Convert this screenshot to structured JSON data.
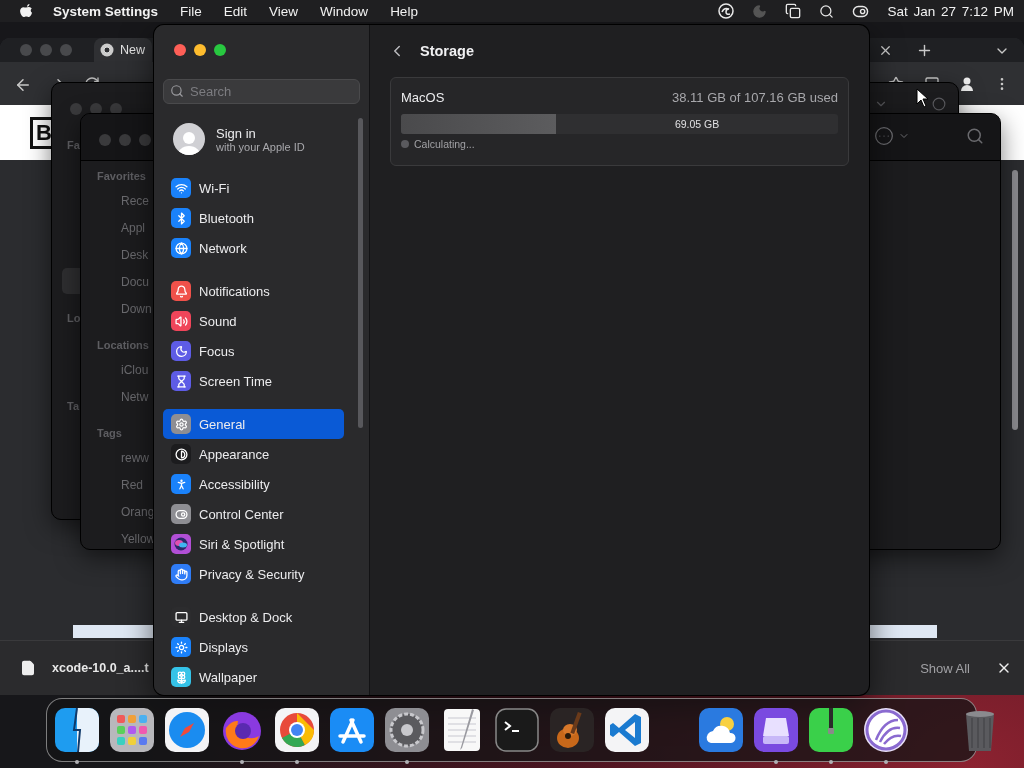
{
  "menubar": {
    "app_name": "System Settings",
    "menus": [
      "File",
      "Edit",
      "View",
      "Window",
      "Help"
    ],
    "date": "Sat Jan 27",
    "time": "7:12 PM"
  },
  "browser": {
    "tab_title": "New",
    "page_logo": "B",
    "download": {
      "file_name": "xcode-10.0_a....t",
      "show_all": "Show All"
    }
  },
  "finder_back": {
    "sidebar_labels": [
      "Fa",
      "Lo",
      "Ta"
    ]
  },
  "finder_front": {
    "sections": [
      {
        "title": "Favorites",
        "items": [
          "Rece",
          "Appl",
          "Desk",
          "Docu",
          "Down"
        ]
      },
      {
        "title": "Locations",
        "items": [
          "iClou",
          "Netw"
        ]
      },
      {
        "title": "Tags",
        "items": [
          "reww",
          "Red",
          "Orang",
          "Yellow"
        ]
      }
    ]
  },
  "settings": {
    "search_placeholder": "Search",
    "account": {
      "title": "Sign in",
      "subtitle": "with your Apple ID"
    },
    "groups": [
      [
        {
          "label": "Wi-Fi",
          "kind": "wifi",
          "color": "#1a82fb",
          "selected": false
        },
        {
          "label": "Bluetooth",
          "kind": "bluetooth",
          "color": "#1a82fb",
          "selected": false
        },
        {
          "label": "Network",
          "kind": "network",
          "color": "#1a82fb",
          "selected": false
        }
      ],
      [
        {
          "label": "Notifications",
          "kind": "notifications",
          "color": "#f0514a",
          "selected": false
        },
        {
          "label": "Sound",
          "kind": "sound",
          "color": "#f0455a",
          "selected": false
        },
        {
          "label": "Focus",
          "kind": "focus",
          "color": "#5e5ce6",
          "selected": false
        },
        {
          "label": "Screen Time",
          "kind": "screen_time",
          "color": "#5e5ce6",
          "selected": false
        }
      ],
      [
        {
          "label": "General",
          "kind": "general",
          "color": "#8e8e93",
          "selected": true
        },
        {
          "label": "Appearance",
          "kind": "appearance",
          "color": "#1c1c1e",
          "selected": false
        },
        {
          "label": "Accessibility",
          "kind": "accessibility",
          "color": "#1a82fb",
          "selected": false
        },
        {
          "label": "Control Center",
          "kind": "control_center",
          "color": "#8e8e93",
          "selected": false
        },
        {
          "label": "Siri & Spotlight",
          "kind": "siri",
          "color": "#b24fd6",
          "selected": false
        },
        {
          "label": "Privacy & Security",
          "kind": "privacy",
          "color": "#2f7cf6",
          "selected": false
        }
      ],
      [
        {
          "label": "Desktop & Dock",
          "kind": "dock",
          "color": "#2c2c2e",
          "selected": false
        },
        {
          "label": "Displays",
          "kind": "displays",
          "color": "#1a82fb",
          "selected": false
        },
        {
          "label": "Wallpaper",
          "kind": "wallpaper",
          "color": "#35c3e8",
          "selected": false
        }
      ]
    ],
    "storage": {
      "title": "Storage",
      "volume": {
        "name": "MacOS",
        "usage": "38.11 GB of 107.16 GB used",
        "level": 0.355,
        "free_label": "69.05 GB",
        "status": "Calculating..."
      }
    }
  },
  "dock": {
    "apps": [
      {
        "kind": "finder",
        "running": true
      },
      {
        "kind": "launchpad",
        "running": false
      },
      {
        "kind": "safari",
        "running": false
      },
      {
        "kind": "firefox",
        "running": true
      },
      {
        "kind": "chrome",
        "running": true
      },
      {
        "kind": "appstore",
        "running": false
      },
      {
        "kind": "settings",
        "running": true
      },
      {
        "kind": "textedit",
        "running": false
      },
      {
        "kind": "terminal",
        "running": false
      },
      {
        "kind": "garageband",
        "running": false
      },
      {
        "kind": "vscode",
        "running": false
      }
    ],
    "recent": [
      {
        "kind": "weather",
        "running": false
      },
      {
        "kind": "drive",
        "running": true
      },
      {
        "kind": "archive",
        "running": true
      },
      {
        "kind": "torrent",
        "running": true
      }
    ],
    "trash": {
      "kind": "trash",
      "running": false
    }
  }
}
